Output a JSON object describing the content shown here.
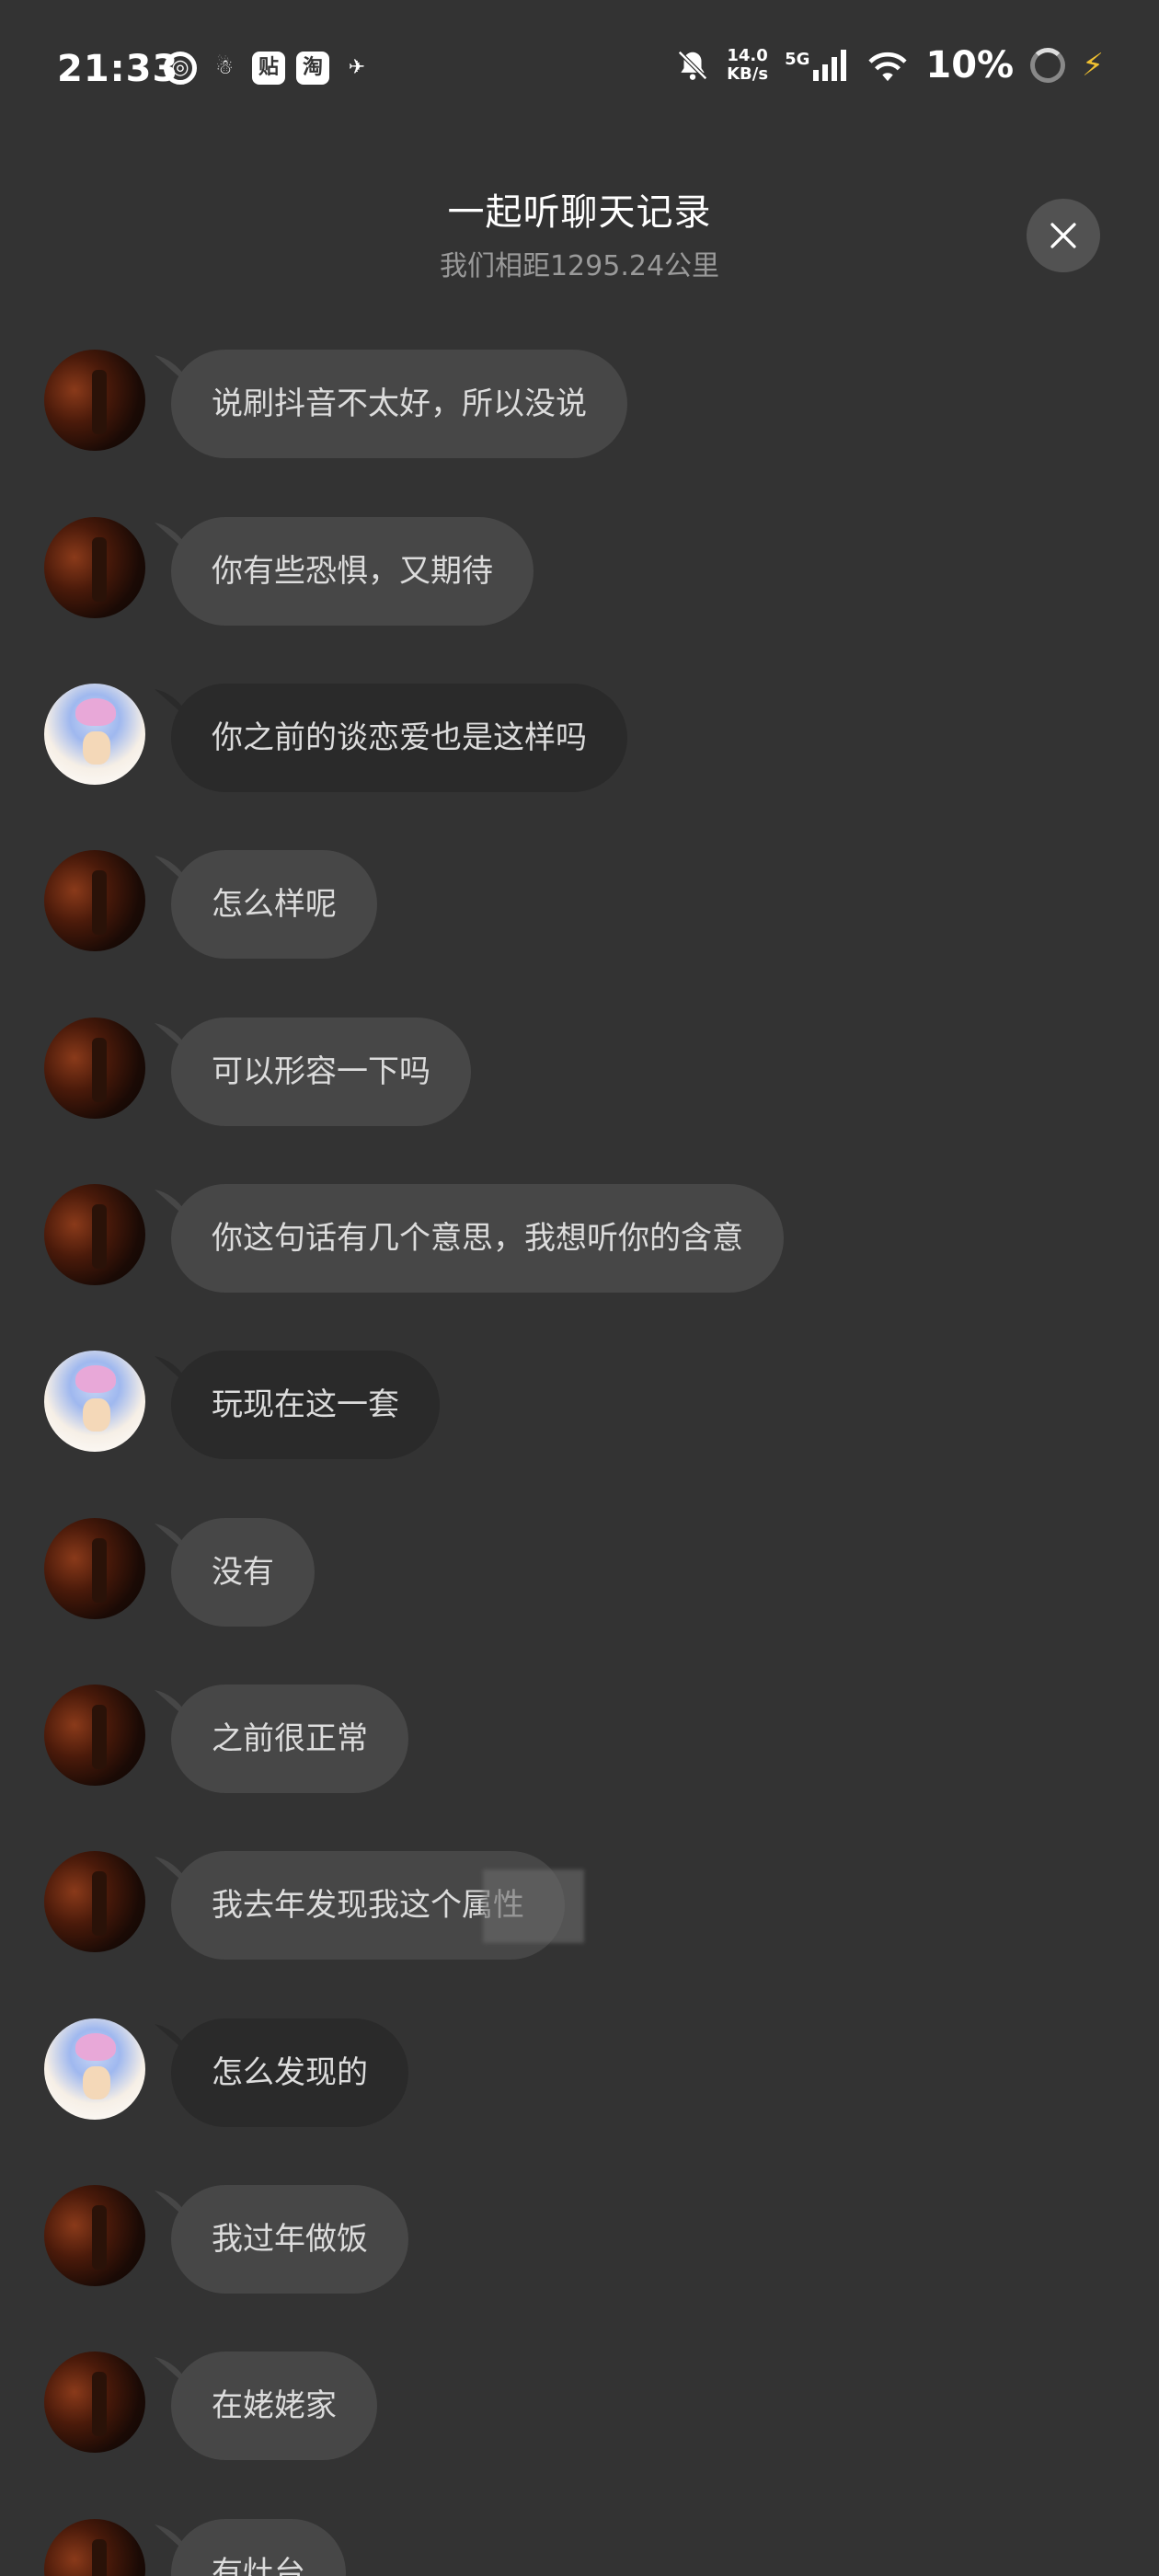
{
  "status_bar": {
    "time": "21:33",
    "apps": [
      "◎",
      "☃",
      "贴",
      "淘",
      "✈"
    ],
    "net_speed_value": "14.0",
    "net_speed_unit": "KB/s",
    "network": "5G",
    "battery": "10%"
  },
  "header": {
    "title": "一起听聊天记录",
    "subtitle": "我们相距1295.24公里"
  },
  "messages": [
    {
      "sender": "other",
      "text": "说刷抖音不太好，所以没说"
    },
    {
      "sender": "other",
      "text": "你有些恐惧，又期待"
    },
    {
      "sender": "self",
      "text": "你之前的谈恋爱也是这样吗"
    },
    {
      "sender": "other",
      "text": "怎么样呢"
    },
    {
      "sender": "other",
      "text": "可以形容一下吗"
    },
    {
      "sender": "other",
      "text": "你这句话有几个意思，我想听你的含意"
    },
    {
      "sender": "self",
      "text": "玩现在这一套"
    },
    {
      "sender": "other",
      "text": "没有"
    },
    {
      "sender": "other",
      "text": "之前很正常"
    },
    {
      "sender": "other",
      "text": "我去年发现我这个属性"
    },
    {
      "sender": "self",
      "text": "怎么发现的"
    },
    {
      "sender": "other",
      "text": "我过年做饭"
    },
    {
      "sender": "other",
      "text": "在姥姥家"
    },
    {
      "sender": "other",
      "text": "有灶台"
    }
  ],
  "colors": {
    "background": "#333333",
    "bubble_other": "#474747",
    "bubble_self": "#2a2a2a",
    "charge": "#f0c030"
  }
}
